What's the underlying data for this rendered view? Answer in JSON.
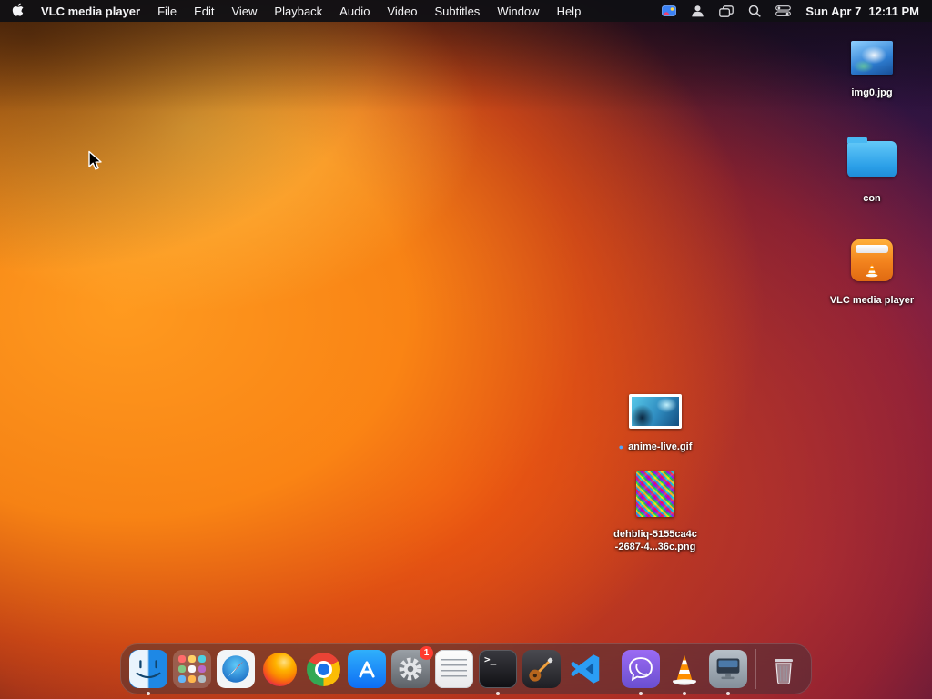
{
  "menu_bar": {
    "app_name": "VLC media player",
    "menus": [
      "File",
      "Edit",
      "View",
      "Playback",
      "Audio",
      "Video",
      "Subtitles",
      "Window",
      "Help"
    ],
    "clock_date": "Sun Apr 7",
    "clock_time": "12:11 PM",
    "status_icons": [
      "screen-mirroring-icon",
      "user-switch-icon",
      "stage-manager-icon",
      "spotlight-icon",
      "control-center-icon"
    ]
  },
  "desktop": {
    "icons": [
      {
        "name": "img0",
        "type": "image-file",
        "label": "img0.jpg"
      },
      {
        "name": "con",
        "type": "folder",
        "label": "con"
      },
      {
        "name": "vlc-drive",
        "type": "drive",
        "label": "VLC media player"
      },
      {
        "name": "anime-live",
        "type": "image-file",
        "label": "anime-live.gif",
        "status_dot": "●"
      },
      {
        "name": "dehbliq",
        "type": "image-file",
        "label": "dehbliq-5155ca4c-2687-4...36c.png",
        "lines": [
          "dehbliq-5155ca4c",
          "-2687-4...36c.png"
        ]
      }
    ]
  },
  "dock": {
    "items": [
      "finder",
      "launchpad",
      "safari",
      "firefox",
      "chrome",
      "app-store",
      "system-settings",
      "textedit",
      "terminal",
      "garageband",
      "vscode",
      "viber",
      "vlc",
      "display-app",
      "trash"
    ],
    "running_apps": [
      "finder",
      "terminal",
      "viber",
      "vlc",
      "display-app"
    ],
    "settings_badge": "1",
    "terminal_glyph": ">_"
  },
  "colors": {
    "menubar_bg": "#101014",
    "badge_red": "#ff3b30",
    "folder_blue": "#2b9fe8",
    "wallpaper_orange": "#ff8c1a",
    "wallpaper_purple": "#7b2d8b",
    "status_dot_blue": "#4da6ff"
  }
}
